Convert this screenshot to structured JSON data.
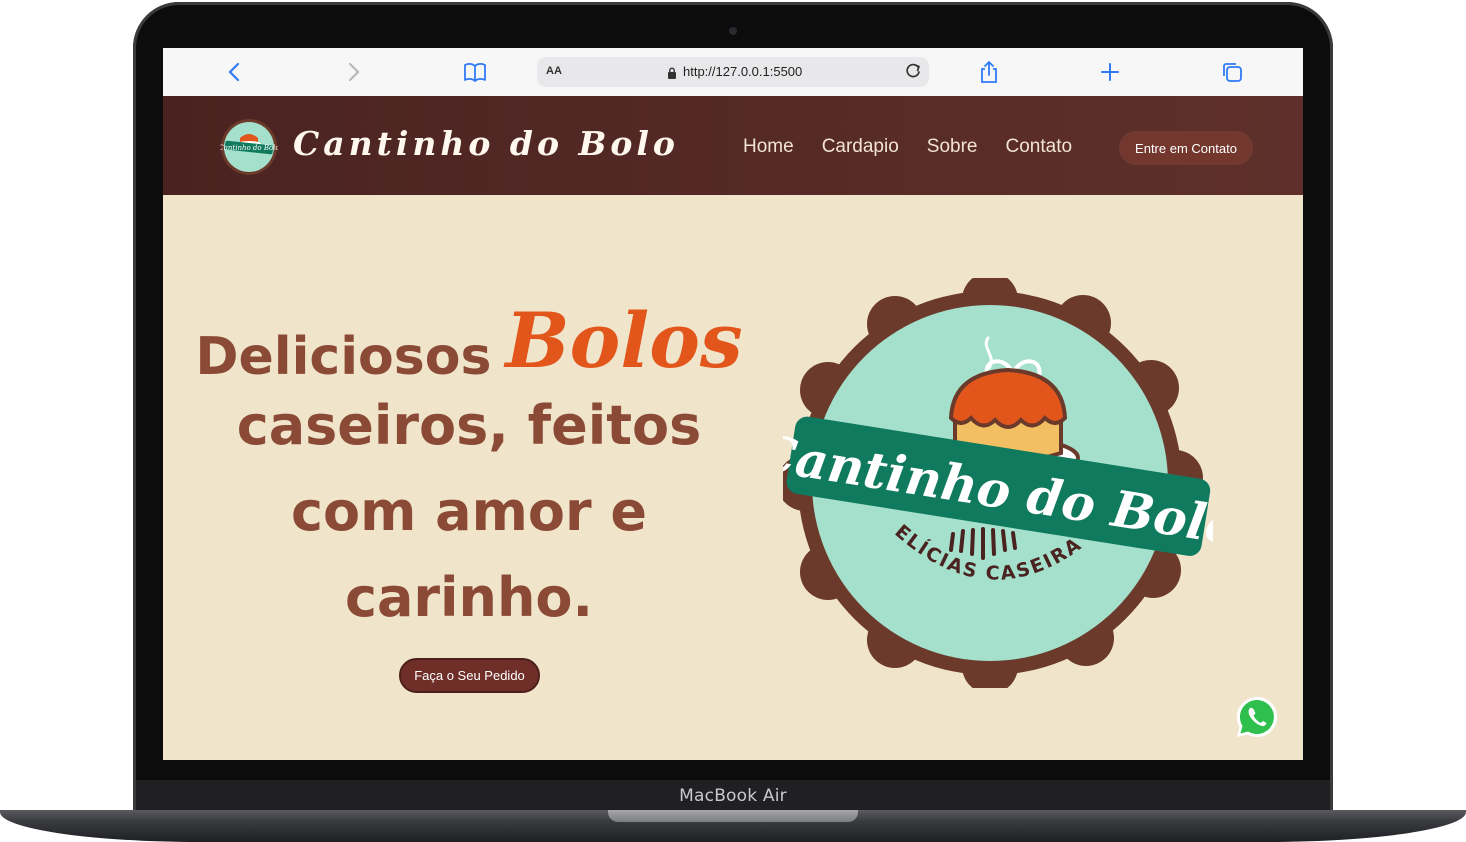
{
  "device": {
    "model_label": "MacBook Air"
  },
  "browser": {
    "text_size_label": "AA",
    "url": "http://127.0.0.1:5500"
  },
  "site": {
    "brand_name": "Cantinho do Bolo",
    "logo_small_text": "Cantinho do Bolo",
    "nav": [
      {
        "label": "Home"
      },
      {
        "label": "Cardapio"
      },
      {
        "label": "Sobre"
      },
      {
        "label": "Contato"
      }
    ],
    "header_cta": "Entre em Contato"
  },
  "hero": {
    "line1_prefix": "Deliciosos",
    "line1_accent": "Bolos",
    "line2": "caseiros, feitos",
    "line3": "com amor e",
    "line4": "carinho.",
    "cta": "Faça o Seu Pedido"
  },
  "hero_logo": {
    "banner_text": "Cantinho do Bolo",
    "tagline": "DELÍCIAS CASEIRAS"
  },
  "colors": {
    "header_bg": "#4a2320",
    "page_bg": "#f0e5cb",
    "heading": "#8a4a36",
    "accent": "#e2561c",
    "logo_mint": "#a4e0cc",
    "logo_banner": "#107a5e",
    "logo_border": "#6b3a2b"
  }
}
